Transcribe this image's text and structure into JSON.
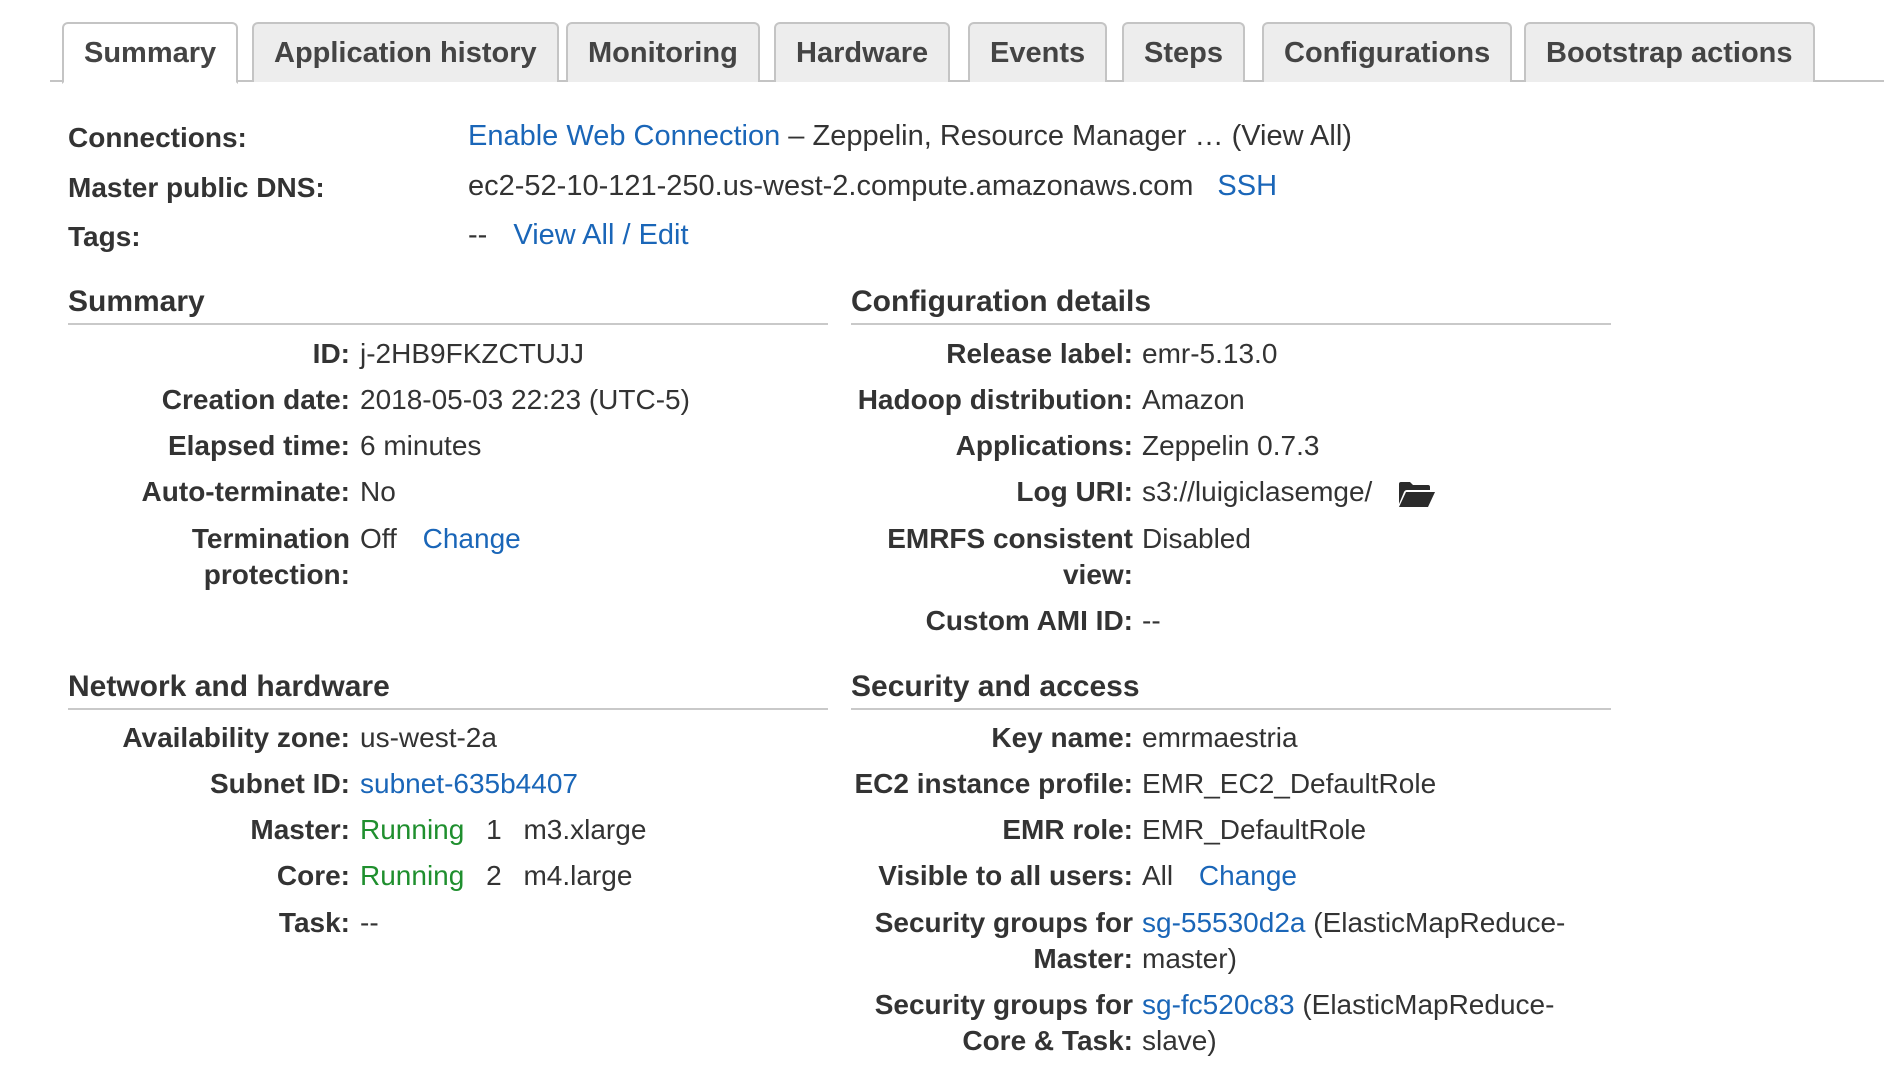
{
  "tabs": [
    {
      "label": "Summary",
      "active": true
    },
    {
      "label": "Application history"
    },
    {
      "label": "Monitoring"
    },
    {
      "label": "Hardware"
    },
    {
      "label": "Events"
    },
    {
      "label": "Steps"
    },
    {
      "label": "Configurations"
    },
    {
      "label": "Bootstrap actions"
    }
  ],
  "top": {
    "connections_label": "Connections:",
    "connections_link": "Enable Web Connection",
    "connections_rest": "– Zeppelin, Resource Manager … (View All)",
    "dns_label": "Master public DNS:",
    "dns_value": "ec2-52-10-121-250.us-west-2.compute.amazonaws.com",
    "dns_ssh": "SSH",
    "tags_label": "Tags:",
    "tags_value": "--",
    "tags_link": "View All / Edit"
  },
  "summary": {
    "title": "Summary",
    "id_label": "ID:",
    "id_value": "j-2HB9FKZCTUJJ",
    "creation_label": "Creation date:",
    "creation_value": "2018-05-03 22:23 (UTC-5)",
    "elapsed_label": "Elapsed time:",
    "elapsed_value": "6 minutes",
    "autoterm_label": "Auto-terminate:",
    "autoterm_value": "No",
    "termprot_label_1": "Termination",
    "termprot_label_2": "protection:",
    "termprot_value": "Off",
    "termprot_change": "Change"
  },
  "config": {
    "title": "Configuration details",
    "release_label": "Release label:",
    "release_value": "emr-5.13.0",
    "hadoop_label": "Hadoop distribution:",
    "hadoop_value": "Amazon",
    "apps_label": "Applications:",
    "apps_value": "Zeppelin 0.7.3",
    "log_label": "Log URI:",
    "log_value": "s3://luigiclasemge/",
    "log_icon": "folder-open-icon",
    "emrfs_label_1": "EMRFS consistent",
    "emrfs_label_2": "view:",
    "emrfs_value": "Disabled",
    "ami_label": "Custom AMI ID:",
    "ami_value": "--"
  },
  "network": {
    "title": "Network and hardware",
    "az_label": "Availability zone:",
    "az_value": "us-west-2a",
    "subnet_label": "Subnet ID:",
    "subnet_value": "subnet-635b4407",
    "master_label": "Master:",
    "master_status": "Running",
    "master_count": "1",
    "master_type": "m3.xlarge",
    "core_label": "Core:",
    "core_status": "Running",
    "core_count": "2",
    "core_type": "m4.large",
    "task_label": "Task:",
    "task_value": "--"
  },
  "security": {
    "title": "Security and access",
    "key_label": "Key name:",
    "key_value": "emrmaestria",
    "ec2_label": "EC2 instance profile:",
    "ec2_value": "EMR_EC2_DefaultRole",
    "role_label": "EMR role:",
    "role_value": "EMR_DefaultRole",
    "visible_label": "Visible to all users:",
    "visible_value": "All",
    "visible_change": "Change",
    "sgm_label_1": "Security groups for",
    "sgm_label_2": "Master:",
    "sgm_link": "sg-55530d2a",
    "sgm_rest_1": "(ElasticMapReduce-",
    "sgm_rest_2": "master)",
    "sgc_label_1": "Security groups for",
    "sgc_label_2": "Core & Task:",
    "sgc_link": "sg-fc520c83",
    "sgc_rest_1": "(ElasticMapReduce-",
    "sgc_rest_2": "slave)"
  },
  "colors": {
    "link": "#1a66b8",
    "running": "#1f8f2e",
    "tab_bg": "#ededed"
  }
}
